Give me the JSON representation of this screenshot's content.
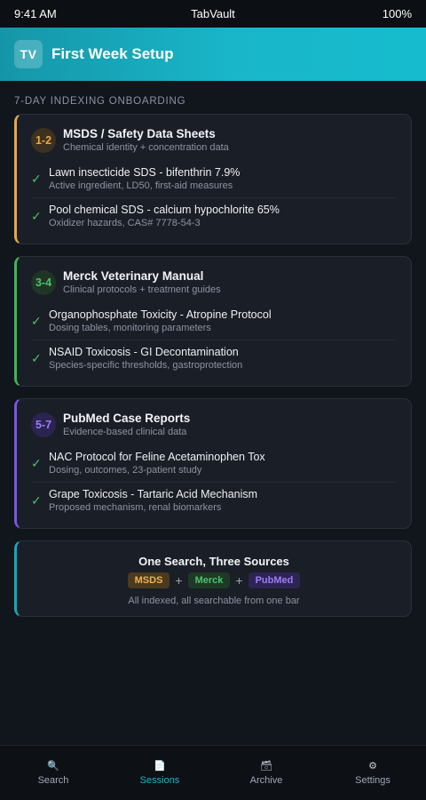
{
  "status_bar": {
    "time": "9:41 AM",
    "carrier": "TabVault",
    "battery": "100%"
  },
  "header": {
    "logo": "TV",
    "title": "First Week Setup"
  },
  "section_label": "7-DAY INDEXING ONBOARDING",
  "cards": [
    {
      "days": "1-2",
      "title": "MSDS / Safety Data Sheets",
      "subtitle": "Chemical identity + concentration data",
      "accent": "#e8a64a",
      "items": [
        {
          "title": "Lawn insecticide SDS - bifenthrin 7.9%",
          "desc": "Active ingredient, LD50, first-aid measures"
        },
        {
          "title": "Pool chemical SDS - calcium hypochlorite 65%",
          "desc": "Oxidizer hazards, CAS# 7778-54-3"
        }
      ]
    },
    {
      "days": "3-4",
      "title": "Merck Veterinary Manual",
      "subtitle": "Clinical protocols + treatment guides",
      "accent": "#3fb655",
      "items": [
        {
          "title": "Organophosphate Toxicity - Atropine Protocol",
          "desc": "Dosing tables, monitoring parameters"
        },
        {
          "title": "NSAID Toxicosis - GI Decontamination",
          "desc": "Species-specific thresholds, gastroprotection"
        }
      ]
    },
    {
      "days": "5-7",
      "title": "PubMed Case Reports",
      "subtitle": "Evidence-based clinical data",
      "accent": "#7b55e8",
      "items": [
        {
          "title": "NAC Protocol for Feline Acetaminophen Tox",
          "desc": "Dosing, outcomes, 23-patient study"
        },
        {
          "title": "Grape Toxicosis - Tartaric Acid Mechanism",
          "desc": "Proposed mechanism, renal biomarkers"
        }
      ]
    }
  ],
  "summary": {
    "title": "One Search, Three Sources",
    "pills": [
      "MSDS",
      "Merck",
      "PubMed"
    ],
    "plus": "+",
    "note": "All indexed, all searchable from one bar",
    "accent": "#1aa6ba"
  },
  "tabs": [
    {
      "label": "Search",
      "icon": "search-icon",
      "glyph": "🔍",
      "active": false
    },
    {
      "label": "Sessions",
      "icon": "document-icon",
      "glyph": "📄",
      "active": true
    },
    {
      "label": "Archive",
      "icon": "archive-icon",
      "glyph": "🗃",
      "active": false
    },
    {
      "label": "Settings",
      "icon": "gear-icon",
      "glyph": "⚙",
      "active": false
    }
  ],
  "colors": {
    "msds_pill_bg": "#4a3a1e",
    "msds_pill_fg": "#f0b052",
    "merck_pill_bg": "#1d3a26",
    "merck_pill_fg": "#4fc26a",
    "pubmed_pill_bg": "#2e2454",
    "pubmed_pill_fg": "#9d7cf5",
    "check": "#4fc26a"
  }
}
